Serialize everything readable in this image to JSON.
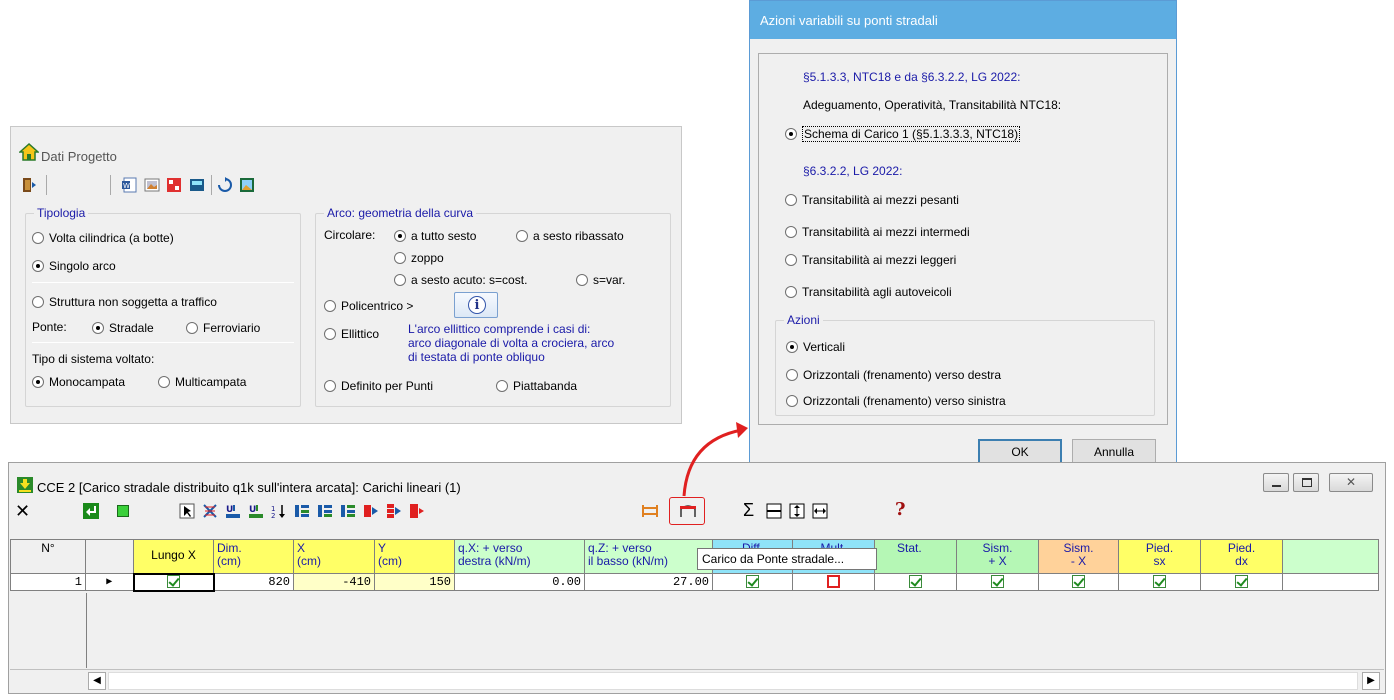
{
  "dati_progetto": {
    "title": "Dati Progetto",
    "tipologia": {
      "legend": "Tipologia",
      "volta": "Volta cilindrica (a botte)",
      "singolo": "Singolo arco",
      "non_traffico": "Struttura non soggetta a traffico",
      "ponte_label": "Ponte:",
      "stradale": "Stradale",
      "ferroviario": "Ferroviario",
      "sistema_label": "Tipo di sistema voltato:",
      "monocampata": "Monocampata",
      "multicampata": "Multicampata"
    },
    "arco": {
      "legend": "Arco: geometria della curva",
      "circolare_label": "Circolare:",
      "tutto_sesto": "a tutto sesto",
      "ribassato": "a sesto ribassato",
      "zoppo": "zoppo",
      "acuto": "a sesto acuto: s=cost.",
      "svar": "s=var.",
      "policentrico": "Policentrico >",
      "ellittico": "Ellittico",
      "ellittico_note_1": "L'arco ellittico comprende i casi di:",
      "ellittico_note_2": "arco diagonale di volta a crociera, arco",
      "ellittico_note_3": "di testata di ponte obliquo",
      "punti": "Definito per Punti",
      "piattabanda": "Piattabanda"
    }
  },
  "dialog": {
    "title": "Azioni variabili su ponti stradali",
    "ref1": "§5.1.3.3, NTC18 e da §6.3.2.2, LG 2022:",
    "desc": "Adeguamento, Operatività, Transitabilità NTC18:",
    "schema1": "Schema di Carico 1 (§5.1.3.3.3, NTC18)",
    "ref2": "§6.3.2.2, LG 2022:",
    "pesanti": "Transitabilità ai mezzi pesanti",
    "intermedi": "Transitabilità ai mezzi intermedi",
    "leggeri": "Transitabilità ai mezzi leggeri",
    "autoveicoli": "Transitabilità agli autoveicoli",
    "azioni_legend": "Azioni",
    "verticali": "Verticali",
    "orizz_destra": "Orizzontali (frenamento) verso destra",
    "orizz_sinistra": "Orizzontali (frenamento) verso sinistra",
    "ok": "OK",
    "annulla": "Annulla"
  },
  "cce": {
    "title": "CCE 2 [Carico stradale distribuito q1k sull'intera arcata]: Carichi lineari (1)",
    "tooltip": "Carico da Ponte stradale...",
    "help": "?",
    "sum": "Σ",
    "headers": {
      "n": "N°",
      "lungo": "Lungo X",
      "dim1": "Dim.",
      "dim2": "(cm)",
      "x1": "X",
      "x2": "(cm)",
      "y1": "Y",
      "y2": "(cm)",
      "qx1": "q.X: + verso",
      "qx2": "destra (kN/m)",
      "qz1": "q.Z: + verso",
      "qz2": "il basso (kN/m)",
      "diff": "Diff.",
      "mult": "Mult.",
      "stat": "Stat.",
      "sismp1": "Sism.",
      "sismp2": "+ X",
      "sismm1": "Sism.",
      "sismm2": "- X",
      "piedsx1": "Pied.",
      "piedsx2": "sx",
      "pieddx1": "Pied.",
      "pieddx2": "dx"
    },
    "row": {
      "n": "1",
      "marker": "▶",
      "dim": "820",
      "x": "-410",
      "y": "150",
      "qx": "0.00",
      "qz": "27.00"
    }
  },
  "colors": {
    "accent": "#5dade2",
    "yellow_header": "#ffff66",
    "green_header": "#ccffcc",
    "peach_header": "#ffd29a",
    "arrow": "#e02020"
  }
}
